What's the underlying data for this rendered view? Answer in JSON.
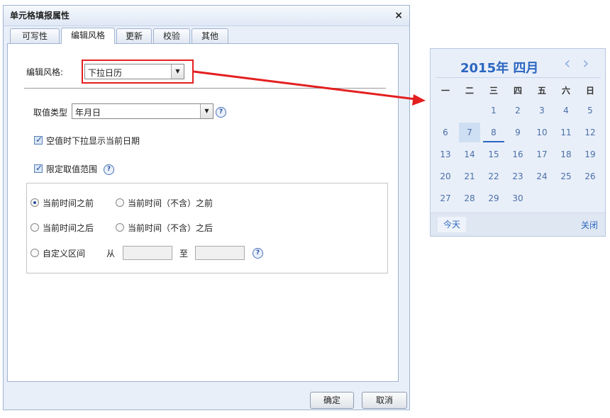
{
  "dialog": {
    "title": "单元格填报属性",
    "close_glyph": "×",
    "tabs": [
      "可写性",
      "编辑风格",
      "更新",
      "校验",
      "其他"
    ],
    "edit_style_label": "编辑风格:",
    "edit_style_value": "下拉日历",
    "value_type_label": "取值类型",
    "value_type_value": "年月日",
    "show_current_date_label": "空值时下拉显示当前日期",
    "limit_range_label": "限定取值范围",
    "radios": {
      "before_now": "当前时间之前",
      "before_now_excl": "当前时间（不含）之前",
      "after_now": "当前时间之后",
      "after_now_excl": "当前时间（不含）之后",
      "custom": "自定义区间"
    },
    "from_label": "从",
    "to_label": "至",
    "ok_label": "确定",
    "cancel_label": "取消",
    "help_glyph": "?"
  },
  "calendar": {
    "title": "2015年 四月",
    "prev_glyph": "‹",
    "next_glyph": "›",
    "weekdays": [
      "一",
      "二",
      "三",
      "四",
      "五",
      "六",
      "日"
    ],
    "days": [
      "1",
      "2",
      "3",
      "4",
      "5",
      "6",
      "7",
      "8",
      "9",
      "10",
      "11",
      "12",
      "13",
      "14",
      "15",
      "16",
      "17",
      "18",
      "19",
      "20",
      "21",
      "22",
      "23",
      "24",
      "25",
      "26",
      "27",
      "28",
      "29",
      "30"
    ],
    "today_label": "今天",
    "close_label": "关闭"
  },
  "colors": {
    "highlight": "#e41f1f",
    "accent": "#2b66c0"
  }
}
